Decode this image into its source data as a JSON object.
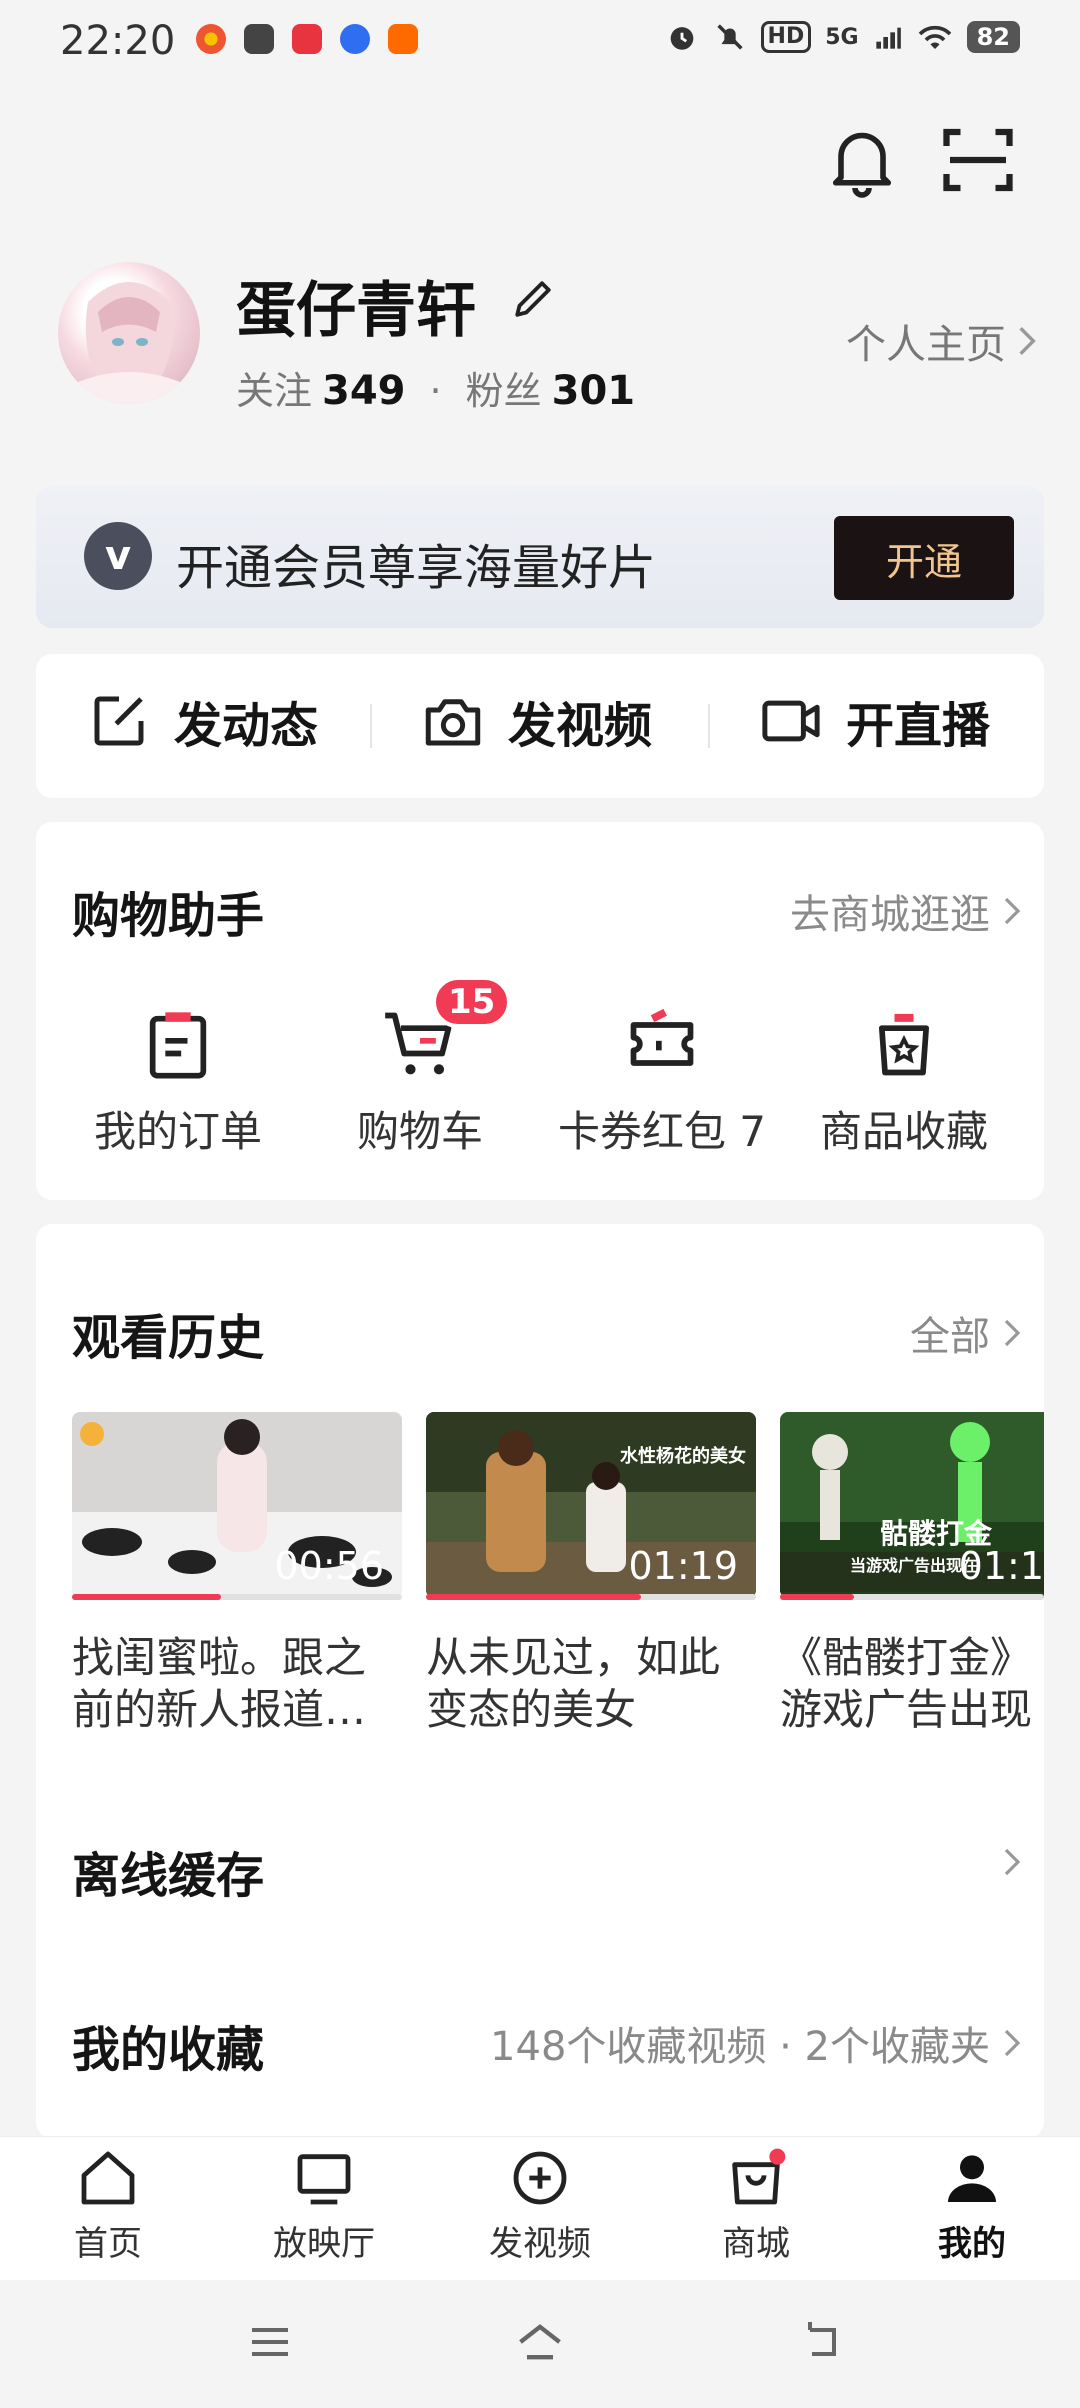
{
  "status_bar": {
    "time": "22:20",
    "network": "5G",
    "hd": "HD",
    "battery": "82"
  },
  "profile": {
    "username": "蛋仔青轩",
    "follow_label": "关注",
    "follow_count": "349",
    "fans_label": "粉丝",
    "fans_count": "301",
    "homepage_link": "个人主页"
  },
  "vip": {
    "logo": "v",
    "text": "开通会员尊享海量好片",
    "button": "开通"
  },
  "actions": [
    {
      "label": "发动态",
      "icon": "edit-square-icon"
    },
    {
      "label": "发视频",
      "icon": "camera-icon"
    },
    {
      "label": "开直播",
      "icon": "video-camera-icon"
    }
  ],
  "shopping": {
    "title": "购物助手",
    "link": "去商城逛逛",
    "items": [
      {
        "label": "我的订单",
        "icon": "clipboard-icon"
      },
      {
        "label": "购物车",
        "icon": "cart-icon",
        "badge": "15"
      },
      {
        "label": "卡券红包 7",
        "icon": "ticket-icon"
      },
      {
        "label": "商品收藏",
        "icon": "bag-star-icon"
      }
    ]
  },
  "history": {
    "title": "观看历史",
    "link": "全部",
    "videos": [
      {
        "duration": "00:56",
        "title": "找闺蜜啦。跟之前的新人报道…",
        "progress": 0.45
      },
      {
        "duration": "01:19",
        "title": "从未见过，如此变态的美女",
        "progress": 0.65,
        "overlay": "水性杨花的美女"
      },
      {
        "duration": "01:1",
        "title": "《骷髅打金》游戏广告出现",
        "progress": 0.28,
        "overlay": "骷髅打金",
        "overlay2": "当游戏广告出现在"
      }
    ]
  },
  "offline_cache": {
    "title": "离线缓存"
  },
  "favorites": {
    "title": "我的收藏",
    "summary": "148个收藏视频 · 2个收藏夹"
  },
  "tabs": [
    {
      "label": "首页",
      "icon": "home-icon"
    },
    {
      "label": "放映厅",
      "icon": "tv-icon"
    },
    {
      "label": "发视频",
      "icon": "plus-circle-icon"
    },
    {
      "label": "商城",
      "icon": "shopping-bag-icon"
    },
    {
      "label": "我的",
      "icon": "person-icon",
      "active": true
    }
  ],
  "colors": {
    "accent": "#f13a54",
    "vip_button_bg": "#1b1213",
    "vip_button_text": "#f0c58e"
  }
}
